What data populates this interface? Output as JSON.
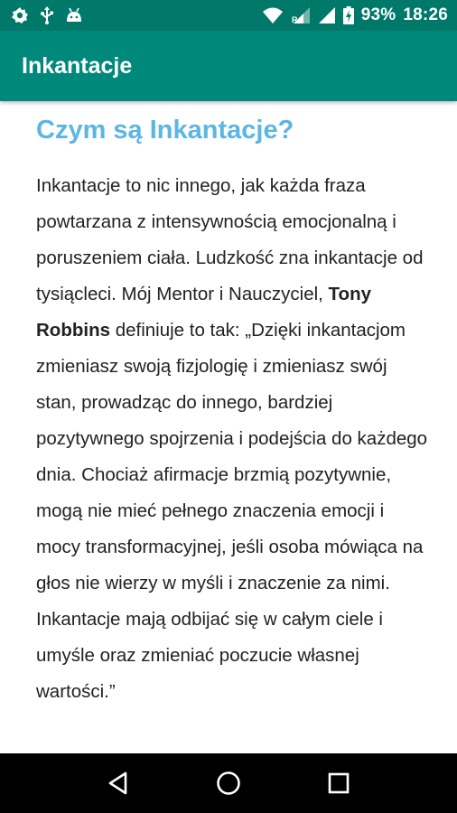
{
  "status_bar": {
    "battery_percent": "93%",
    "time": "18:26",
    "icons": [
      "settings-gear-icon",
      "usb-icon",
      "android-icon",
      "wifi-icon",
      "signal-r-icon",
      "signal-icon",
      "battery-charging-icon"
    ]
  },
  "app_bar": {
    "title": "Inkantacje",
    "color": "#00897b"
  },
  "article": {
    "heading": "Czym są Inkantacje?",
    "heading_color": "#5bb6e2",
    "paragraph_before_bold": "Inkantacje to nic innego, jak każda fraza powtarzana z intensywnością emocjonalną i poruszeniem ciała. Ludzkość zna inkantacje od tysiącleci. Mój Mentor i Nauczyciel, ",
    "paragraph_bold": "Tony Robbins",
    "paragraph_after_bold": " definiuje to tak: „Dzięki inkantacjom zmieniasz swoją fizjologię i zmieniasz swój stan, prowadząc do innego, bardziej pozytywnego spojrzenia i podejścia do każdego dnia. Chociaż afirmacje brzmią pozytywnie, mogą nie mieć pełnego znaczenia emocji i mocy transformacyjnej, jeśli osoba mówiąca na głos nie wierzy w myśli i znaczenie za nimi. Inkantacje mają odbijać się w całym ciele i umyśle oraz zmieniać poczucie własnej wartości.”"
  },
  "nav_bar": {
    "buttons": [
      "back-icon",
      "home-icon",
      "recents-icon"
    ]
  }
}
